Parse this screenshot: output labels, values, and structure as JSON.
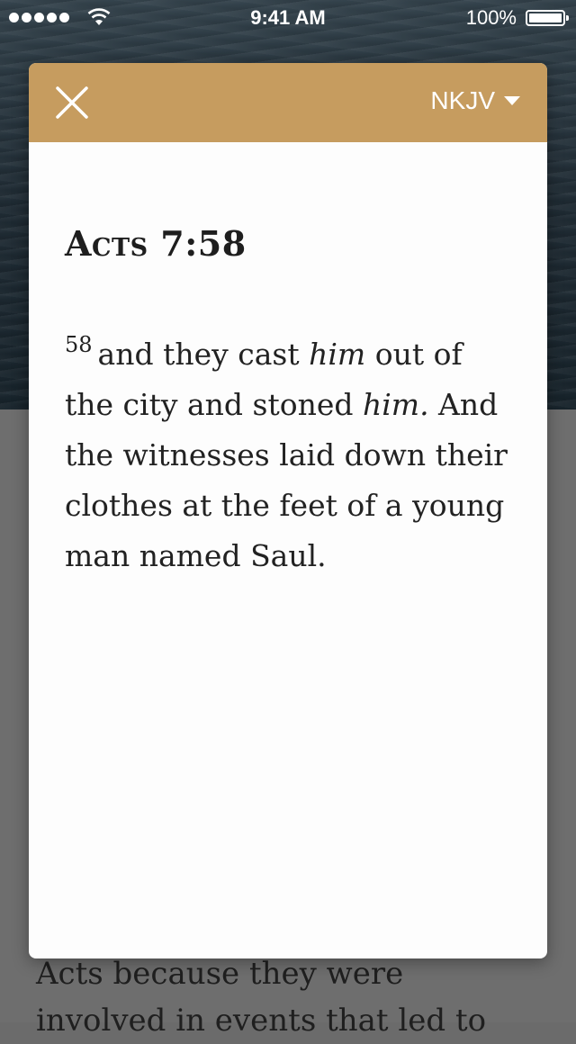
{
  "status_bar": {
    "time": "9:41 AM",
    "battery": "100%"
  },
  "background": {
    "text": "Acts because they were involved in events that led to"
  },
  "modal": {
    "version": "NKJV",
    "reference": "Acts 7:58",
    "verse_number": "58",
    "verse_segments": [
      {
        "text": "and they cast ",
        "italic": false
      },
      {
        "text": "him",
        "italic": true
      },
      {
        "text": " out of the city and stoned ",
        "italic": false
      },
      {
        "text": "him.",
        "italic": true
      },
      {
        "text": " And the witnesses laid down their clothes at the feet of a young man named Saul.",
        "italic": false
      }
    ]
  }
}
